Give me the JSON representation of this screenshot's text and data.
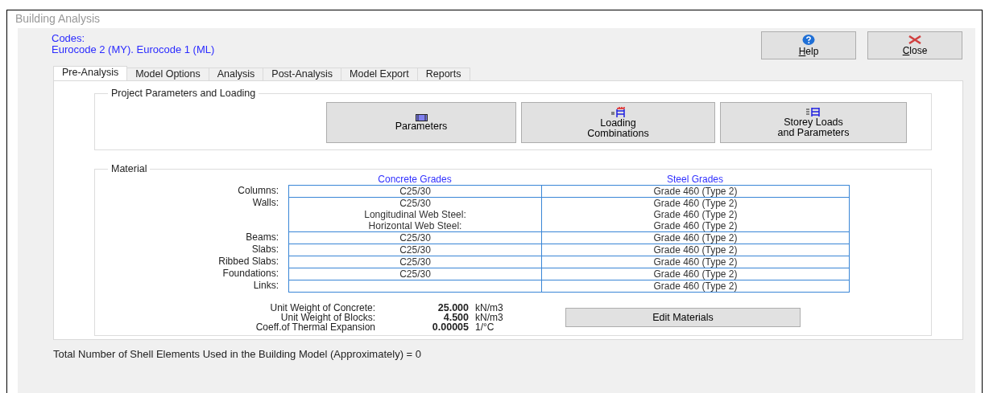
{
  "window": {
    "title": "Building Analysis"
  },
  "codes": {
    "label": "Codes:",
    "value": "Eurocode 2 (MY).  Eurocode 1 (ML)"
  },
  "header_buttons": [
    {
      "kind": "help",
      "label": "Help"
    },
    {
      "kind": "close",
      "label": "Close"
    }
  ],
  "tabs": [
    {
      "label": "Pre-Analysis",
      "selected": true
    },
    {
      "label": "Model Options",
      "selected": false
    },
    {
      "label": "Analysis",
      "selected": false
    },
    {
      "label": "Post-Analysis",
      "selected": false
    },
    {
      "label": "Model Export",
      "selected": false
    },
    {
      "label": "Reports",
      "selected": false
    }
  ],
  "project_group": {
    "title": "Project Parameters and Loading",
    "buttons": [
      {
        "kind": "parameters",
        "lines": [
          "Parameters"
        ]
      },
      {
        "kind": "loading",
        "lines": [
          "Loading",
          "Combinations"
        ]
      },
      {
        "kind": "storey",
        "lines": [
          "Storey Loads",
          "and Parameters"
        ]
      }
    ]
  },
  "material_group": {
    "title": "Material",
    "columns": [
      "Concrete Grades",
      "Steel Grades"
    ],
    "rows": [
      {
        "labels": [
          "Columns:"
        ],
        "concrete": [
          "C25/30"
        ],
        "steel": [
          "Grade 460 (Type 2)"
        ]
      },
      {
        "labels": [
          "Walls:"
        ],
        "concrete": [
          "C25/30",
          "Longitudinal Web Steel:",
          "Horizontal Web Steel:"
        ],
        "steel": [
          "Grade 460 (Type 2)",
          "Grade 460 (Type 2)",
          "Grade 460 (Type 2)"
        ]
      },
      {
        "labels": [
          "Beams:"
        ],
        "concrete": [
          "C25/30"
        ],
        "steel": [
          "Grade 460 (Type 2)"
        ]
      },
      {
        "labels": [
          "Slabs:"
        ],
        "concrete": [
          "C25/30"
        ],
        "steel": [
          "Grade 460 (Type 2)"
        ]
      },
      {
        "labels": [
          "Ribbed Slabs:"
        ],
        "concrete": [
          "C25/30"
        ],
        "steel": [
          "Grade 460 (Type 2)"
        ]
      },
      {
        "labels": [
          "Foundations:"
        ],
        "concrete": [
          "C25/30"
        ],
        "steel": [
          "Grade 460 (Type 2)"
        ]
      },
      {
        "labels": [
          "Links:"
        ],
        "concrete": [],
        "steel": [
          "Grade 460 (Type 2)"
        ]
      }
    ],
    "properties": [
      {
        "label": "Unit Weight of Concrete:",
        "value": "25.000",
        "unit": "kN/m3"
      },
      {
        "label": "Unit Weight of Blocks:",
        "value": "4.500",
        "unit": "kN/m3"
      },
      {
        "label": "Coeff.of Thermal Expansion",
        "value": "0.00005",
        "unit": "1/°C"
      }
    ],
    "edit_button": "Edit Materials"
  },
  "status": "Total Number of Shell Elements Used in the Building Model (Approximately) = 0"
}
